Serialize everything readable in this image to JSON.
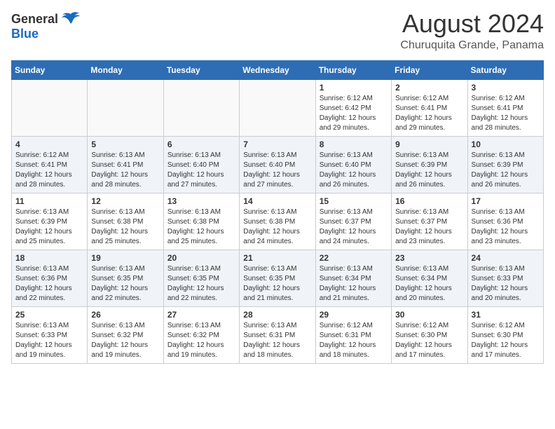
{
  "logo": {
    "general": "General",
    "blue": "Blue"
  },
  "title": {
    "month_year": "August 2024",
    "location": "Churuquita Grande, Panama"
  },
  "weekdays": [
    "Sunday",
    "Monday",
    "Tuesday",
    "Wednesday",
    "Thursday",
    "Friday",
    "Saturday"
  ],
  "weeks": [
    [
      {
        "day": "",
        "info": ""
      },
      {
        "day": "",
        "info": ""
      },
      {
        "day": "",
        "info": ""
      },
      {
        "day": "",
        "info": ""
      },
      {
        "day": "1",
        "info": "Sunrise: 6:12 AM\nSunset: 6:42 PM\nDaylight: 12 hours\nand 29 minutes."
      },
      {
        "day": "2",
        "info": "Sunrise: 6:12 AM\nSunset: 6:41 PM\nDaylight: 12 hours\nand 29 minutes."
      },
      {
        "day": "3",
        "info": "Sunrise: 6:12 AM\nSunset: 6:41 PM\nDaylight: 12 hours\nand 28 minutes."
      }
    ],
    [
      {
        "day": "4",
        "info": "Sunrise: 6:12 AM\nSunset: 6:41 PM\nDaylight: 12 hours\nand 28 minutes."
      },
      {
        "day": "5",
        "info": "Sunrise: 6:13 AM\nSunset: 6:41 PM\nDaylight: 12 hours\nand 28 minutes."
      },
      {
        "day": "6",
        "info": "Sunrise: 6:13 AM\nSunset: 6:40 PM\nDaylight: 12 hours\nand 27 minutes."
      },
      {
        "day": "7",
        "info": "Sunrise: 6:13 AM\nSunset: 6:40 PM\nDaylight: 12 hours\nand 27 minutes."
      },
      {
        "day": "8",
        "info": "Sunrise: 6:13 AM\nSunset: 6:40 PM\nDaylight: 12 hours\nand 26 minutes."
      },
      {
        "day": "9",
        "info": "Sunrise: 6:13 AM\nSunset: 6:39 PM\nDaylight: 12 hours\nand 26 minutes."
      },
      {
        "day": "10",
        "info": "Sunrise: 6:13 AM\nSunset: 6:39 PM\nDaylight: 12 hours\nand 26 minutes."
      }
    ],
    [
      {
        "day": "11",
        "info": "Sunrise: 6:13 AM\nSunset: 6:39 PM\nDaylight: 12 hours\nand 25 minutes."
      },
      {
        "day": "12",
        "info": "Sunrise: 6:13 AM\nSunset: 6:38 PM\nDaylight: 12 hours\nand 25 minutes."
      },
      {
        "day": "13",
        "info": "Sunrise: 6:13 AM\nSunset: 6:38 PM\nDaylight: 12 hours\nand 25 minutes."
      },
      {
        "day": "14",
        "info": "Sunrise: 6:13 AM\nSunset: 6:38 PM\nDaylight: 12 hours\nand 24 minutes."
      },
      {
        "day": "15",
        "info": "Sunrise: 6:13 AM\nSunset: 6:37 PM\nDaylight: 12 hours\nand 24 minutes."
      },
      {
        "day": "16",
        "info": "Sunrise: 6:13 AM\nSunset: 6:37 PM\nDaylight: 12 hours\nand 23 minutes."
      },
      {
        "day": "17",
        "info": "Sunrise: 6:13 AM\nSunset: 6:36 PM\nDaylight: 12 hours\nand 23 minutes."
      }
    ],
    [
      {
        "day": "18",
        "info": "Sunrise: 6:13 AM\nSunset: 6:36 PM\nDaylight: 12 hours\nand 22 minutes."
      },
      {
        "day": "19",
        "info": "Sunrise: 6:13 AM\nSunset: 6:35 PM\nDaylight: 12 hours\nand 22 minutes."
      },
      {
        "day": "20",
        "info": "Sunrise: 6:13 AM\nSunset: 6:35 PM\nDaylight: 12 hours\nand 22 minutes."
      },
      {
        "day": "21",
        "info": "Sunrise: 6:13 AM\nSunset: 6:35 PM\nDaylight: 12 hours\nand 21 minutes."
      },
      {
        "day": "22",
        "info": "Sunrise: 6:13 AM\nSunset: 6:34 PM\nDaylight: 12 hours\nand 21 minutes."
      },
      {
        "day": "23",
        "info": "Sunrise: 6:13 AM\nSunset: 6:34 PM\nDaylight: 12 hours\nand 20 minutes."
      },
      {
        "day": "24",
        "info": "Sunrise: 6:13 AM\nSunset: 6:33 PM\nDaylight: 12 hours\nand 20 minutes."
      }
    ],
    [
      {
        "day": "25",
        "info": "Sunrise: 6:13 AM\nSunset: 6:33 PM\nDaylight: 12 hours\nand 19 minutes."
      },
      {
        "day": "26",
        "info": "Sunrise: 6:13 AM\nSunset: 6:32 PM\nDaylight: 12 hours\nand 19 minutes."
      },
      {
        "day": "27",
        "info": "Sunrise: 6:13 AM\nSunset: 6:32 PM\nDaylight: 12 hours\nand 19 minutes."
      },
      {
        "day": "28",
        "info": "Sunrise: 6:13 AM\nSunset: 6:31 PM\nDaylight: 12 hours\nand 18 minutes."
      },
      {
        "day": "29",
        "info": "Sunrise: 6:12 AM\nSunset: 6:31 PM\nDaylight: 12 hours\nand 18 minutes."
      },
      {
        "day": "30",
        "info": "Sunrise: 6:12 AM\nSunset: 6:30 PM\nDaylight: 12 hours\nand 17 minutes."
      },
      {
        "day": "31",
        "info": "Sunrise: 6:12 AM\nSunset: 6:30 PM\nDaylight: 12 hours\nand 17 minutes."
      }
    ]
  ]
}
